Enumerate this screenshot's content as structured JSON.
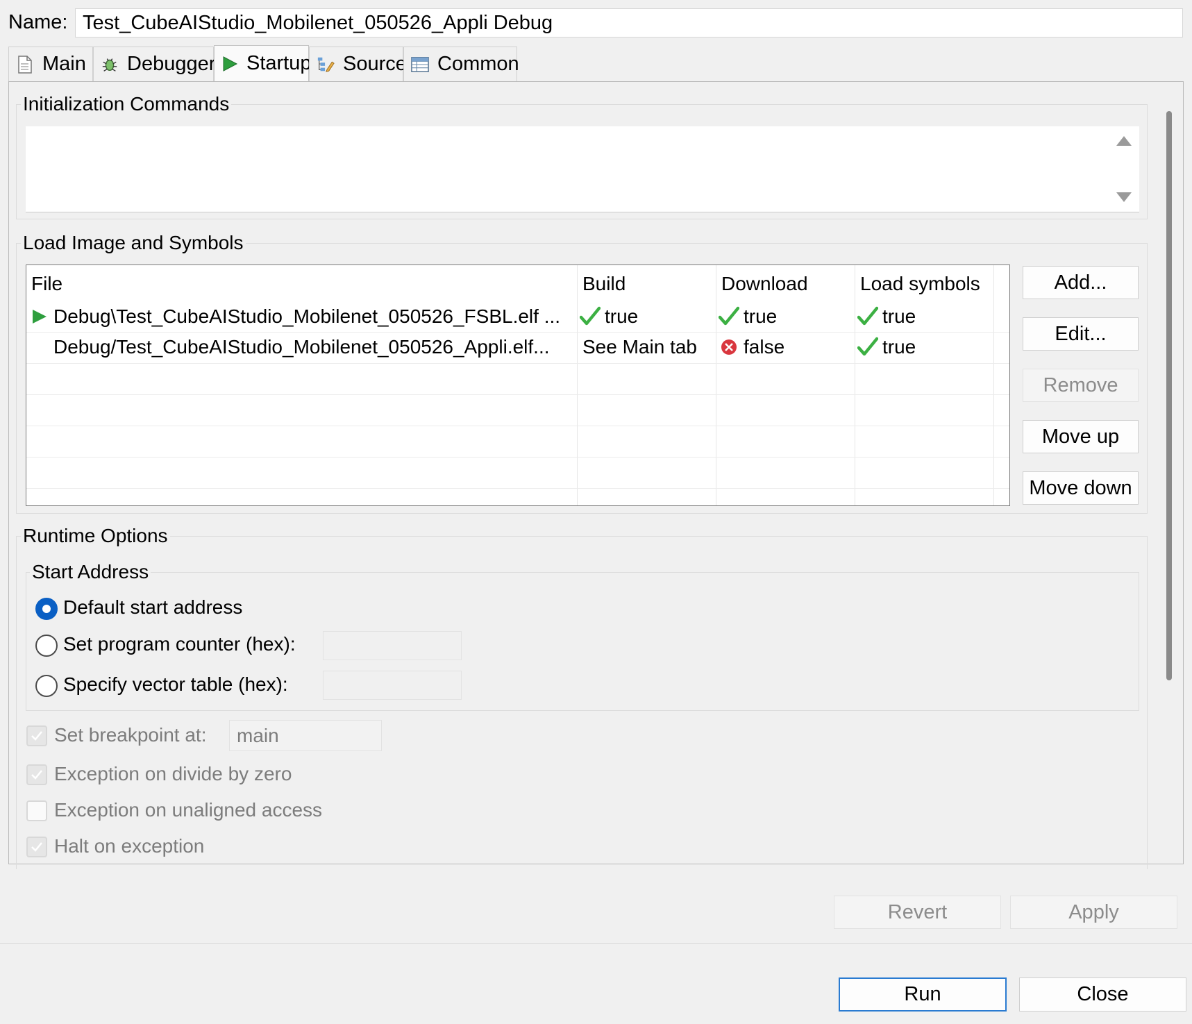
{
  "name": {
    "label": "Name:",
    "value": "Test_CubeAIStudio_Mobilenet_050526_Appli Debug"
  },
  "tabs": [
    {
      "label": "Main",
      "icon": "document-icon"
    },
    {
      "label": "Debugger",
      "icon": "bug-icon"
    },
    {
      "label": "Startup",
      "icon": "play-icon",
      "active": true
    },
    {
      "label": "Source",
      "icon": "source-lookup-icon"
    },
    {
      "label": "Common",
      "icon": "table-icon"
    }
  ],
  "init_commands": {
    "title": "Initialization Commands",
    "value": ""
  },
  "load_image": {
    "title": "Load Image and Symbols",
    "columns": [
      "File",
      "Build",
      "Download",
      "Load symbols"
    ],
    "rows": [
      {
        "file": "Debug\\Test_CubeAIStudio_Mobilenet_050526_FSBL.elf ...",
        "build": "true",
        "download": "true",
        "load_symbols": "true",
        "build_icon": "check-icon",
        "download_icon": "check-icon",
        "symbols_icon": "check-icon",
        "row_icon": "play-icon"
      },
      {
        "file": "Debug/Test_CubeAIStudio_Mobilenet_050526_Appli.elf...",
        "build": "See Main tab",
        "download": "false",
        "load_symbols": "true",
        "download_icon": "error-icon",
        "symbols_icon": "check-icon"
      }
    ],
    "buttons": {
      "add": "Add...",
      "edit": "Edit...",
      "remove": "Remove",
      "move_up": "Move up",
      "move_down": "Move down"
    }
  },
  "runtime": {
    "title": "Runtime Options",
    "start_address": {
      "title": "Start Address",
      "options": [
        "Default start address",
        "Set program counter (hex):",
        "Specify vector table (hex):"
      ],
      "selected": "Default start address"
    },
    "breakpoint": {
      "label": "Set breakpoint at:",
      "value": "main",
      "checked": true
    },
    "exceptions": [
      {
        "label": "Exception on divide by zero",
        "checked": true
      },
      {
        "label": "Exception on unaligned access",
        "checked": false
      },
      {
        "label": "Halt on exception",
        "checked": true
      }
    ]
  },
  "footer": {
    "revert": "Revert",
    "apply": "Apply",
    "run": "Run",
    "close": "Close"
  },
  "colors": {
    "accent": "#0a5fc4",
    "check": "#3cb043",
    "error": "#d9363e",
    "play": "#2e9e3e"
  }
}
